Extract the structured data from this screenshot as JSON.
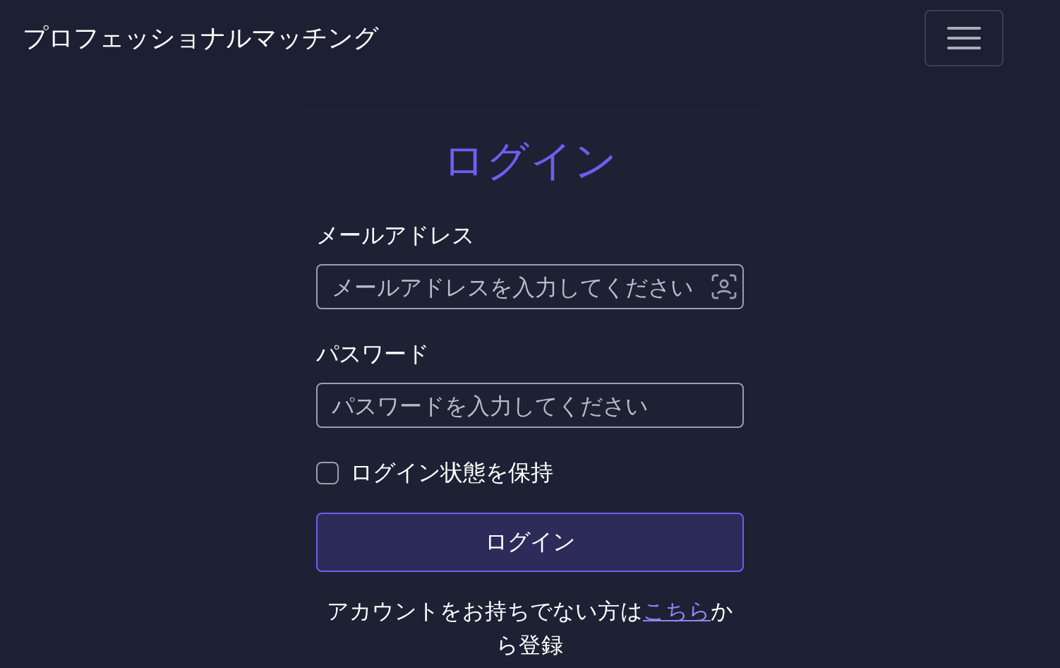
{
  "navbar": {
    "brand": "プロフェッショナルマッチング",
    "menu_expanded": false
  },
  "login": {
    "title": "ログイン",
    "email": {
      "label": "メールアドレス",
      "placeholder": "メールアドレスを入力してください"
    },
    "password": {
      "label": "パスワード",
      "placeholder": "パスワードを入力してください"
    },
    "remember": {
      "label": "ログイン状態を保持",
      "checked": false
    },
    "submit": "ログイン",
    "signup": {
      "prefix": "アカウントをお持ちでない方は",
      "link": "こちら",
      "suffix": "から登録"
    }
  }
}
